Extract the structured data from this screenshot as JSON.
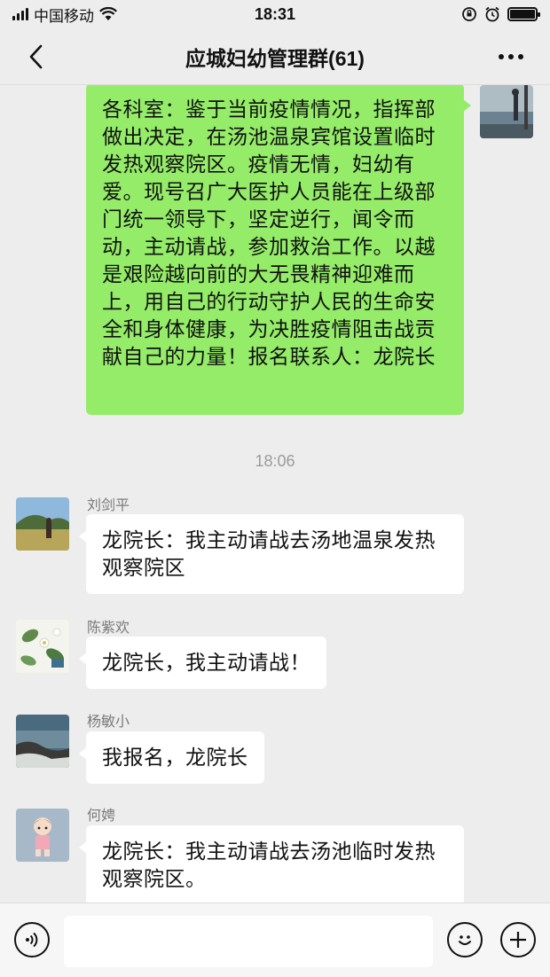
{
  "status_bar": {
    "carrier": "中国移动",
    "time": "18:31"
  },
  "nav": {
    "title": "应城妇幼管理群(61)"
  },
  "messages": [
    {
      "type": "self",
      "text": "各科室：鉴于当前疫情情况，指挥部做出决定，在汤池温泉宾馆设置临时发热观察院区。疫情无情，妇幼有爱。现号召广大医护人员能在上级部门统一领导下，坚定逆行，闻令而动，主动请战，参加救治工作。以越是艰险越向前的大无畏精神迎难而上，用自己的行动守护人民的生命安全和身体健康，为决胜疫情阻击战贡献自己的力量！报名联系人：龙院长"
    },
    {
      "type": "time",
      "text": "18:06"
    },
    {
      "type": "other",
      "sender": "刘剑平",
      "text": "龙院长：我主动请战去汤地温泉发热观察院区"
    },
    {
      "type": "other",
      "sender": "陈紫欢",
      "text": "龙院长，我主动请战！"
    },
    {
      "type": "other",
      "sender": "杨敏小",
      "text": "我报名，龙院长"
    },
    {
      "type": "other",
      "sender": "何娉",
      "text": "龙院长：我主动请战去汤池临时发热观察院区。"
    }
  ],
  "input": {
    "value": "",
    "placeholder": ""
  },
  "colors": {
    "self_bubble": "#95ec69",
    "other_bubble": "#ffffff",
    "background": "#ededed"
  },
  "icons": [
    "signal-icon",
    "wifi-icon",
    "back-icon",
    "more-icon",
    "lock-rotation-icon",
    "alarm-icon",
    "battery-icon",
    "voice-icon",
    "emoji-icon",
    "plus-icon"
  ]
}
